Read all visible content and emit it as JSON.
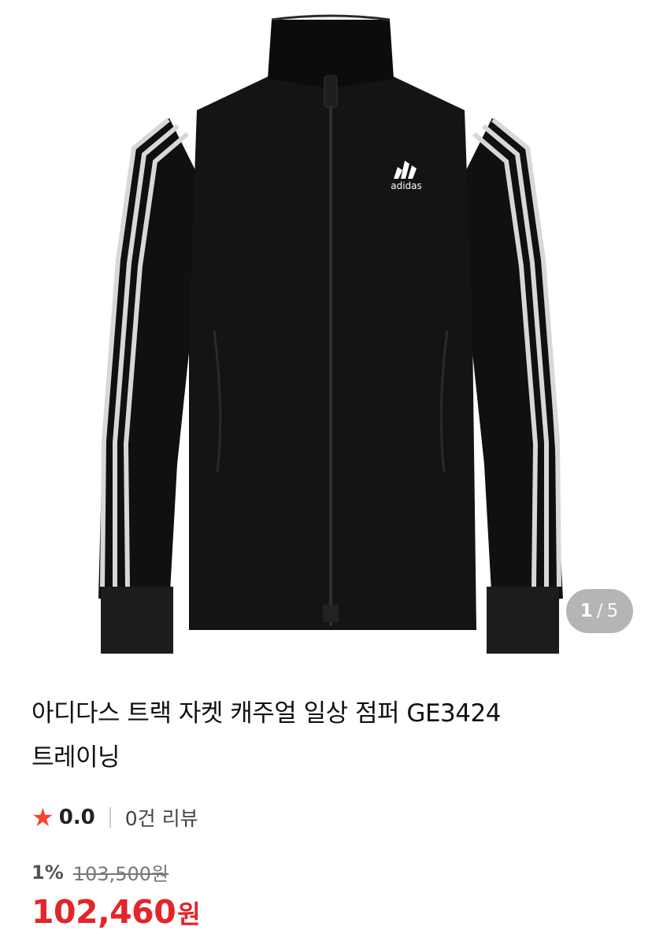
{
  "product": {
    "image_alt": "adidas black track jacket",
    "logo_text": "adidas",
    "counter": {
      "current": "1",
      "separator": "/",
      "total": "5"
    },
    "title": "아디다스 트랙 자켓 캐주얼 일상 점퍼 GE3424\n트레이닝",
    "rating": {
      "score": "0.0",
      "reviews": "0건 리뷰"
    },
    "price": {
      "discount": "1%",
      "original": "103,500원",
      "final": "102,460",
      "currency": "원"
    }
  },
  "colors": {
    "accent": "#e4242b",
    "star": "#f0462d"
  }
}
